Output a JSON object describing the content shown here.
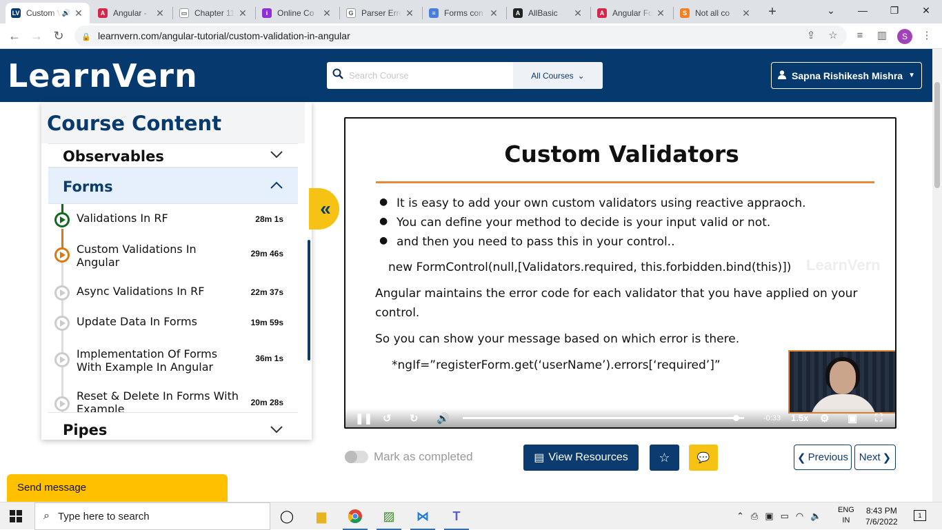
{
  "browser": {
    "tabs": [
      {
        "title": "Custom Validations In Angular",
        "favicon_color": "#0b3a6e",
        "favicon_glyph": "LV",
        "active": true,
        "muted_icon": true
      },
      {
        "title": "Angular - ",
        "favicon_color": "#d6264a",
        "favicon_glyph": "A"
      },
      {
        "title": "Chapter 11",
        "favicon_color": "#ffffff",
        "favicon_glyph": "▭"
      },
      {
        "title": "Online Co",
        "favicon_color": "#8f2fd5",
        "favicon_glyph": "i"
      },
      {
        "title": "Parser Erro",
        "favicon_color": "#ffffff",
        "favicon_glyph": "G"
      },
      {
        "title": "Forms con",
        "favicon_color": "#4a7de0",
        "favicon_glyph": "≡"
      },
      {
        "title": "AllBasic",
        "favicon_color": "#222222",
        "favicon_glyph": "A"
      },
      {
        "title": "Angular Fo",
        "favicon_color": "#d6264a",
        "favicon_glyph": "A"
      },
      {
        "title": "Not all co",
        "favicon_color": "#f48024",
        "favicon_glyph": "S"
      }
    ],
    "url": "learnvern.com/angular-tutorial/custom-validation-in-angular",
    "profile_initial": "S"
  },
  "header": {
    "logo": "LearnVern",
    "search_placeholder": "Search Course",
    "courses_select": "All Courses",
    "user_name": "Sapna Rishikesh Mishra"
  },
  "sidebar": {
    "title": "Course Content",
    "sections": [
      {
        "name": "Observables",
        "expanded": false
      },
      {
        "name": "Forms",
        "expanded": true
      },
      {
        "name": "Pipes",
        "expanded": false
      }
    ],
    "lessons": [
      {
        "name": "Validations In RF",
        "duration": "28m 1s",
        "status": "done"
      },
      {
        "name": "Custom Validations In Angular",
        "duration": "29m 46s",
        "status": "current"
      },
      {
        "name": "Async Validations In RF",
        "duration": "22m 37s",
        "status": "pending"
      },
      {
        "name": "Update Data In Forms",
        "duration": "19m 59s",
        "status": "pending"
      },
      {
        "name": "Implementation Of Forms With Example In Angular",
        "duration": "36m 1s",
        "status": "pending"
      },
      {
        "name": "Reset & Delete In Forms With Example",
        "duration": "20m 28s",
        "status": "pending"
      }
    ]
  },
  "slide": {
    "title": "Custom Validators",
    "bullets": [
      "It is easy to add your own custom validators using reactive appraoch.",
      "You can define your method to decide is your input valid or not.",
      "and then you need to pass this in  your control.."
    ],
    "code_line": "new FormControl(null,[Validators.required, this.forbidden.bind(this)])",
    "paragraph_1a": "Angular maintains the error code for each validator that you have applied on your",
    "paragraph_1b": "control.",
    "paragraph_2": "So you can show your message based on which error is there.",
    "code_line_2": "*ngIf=”registerForm.get(‘userName’).errors[‘required’]”",
    "watermark": "LearnVern"
  },
  "player": {
    "progress_fraction": 0.97,
    "time_remaining": "-0:33",
    "speed": "1.5x"
  },
  "actions": {
    "mark_completed": "Mark as completed",
    "view_resources": "View Resources",
    "previous": "Previous",
    "next": "Next",
    "send_message": "Send message"
  },
  "taskbar": {
    "search_placeholder": "Type here to search",
    "lang_1": "ENG",
    "lang_2": "IN",
    "time": "8:43 PM",
    "date": "7/6/2022",
    "notification_count": "1"
  }
}
